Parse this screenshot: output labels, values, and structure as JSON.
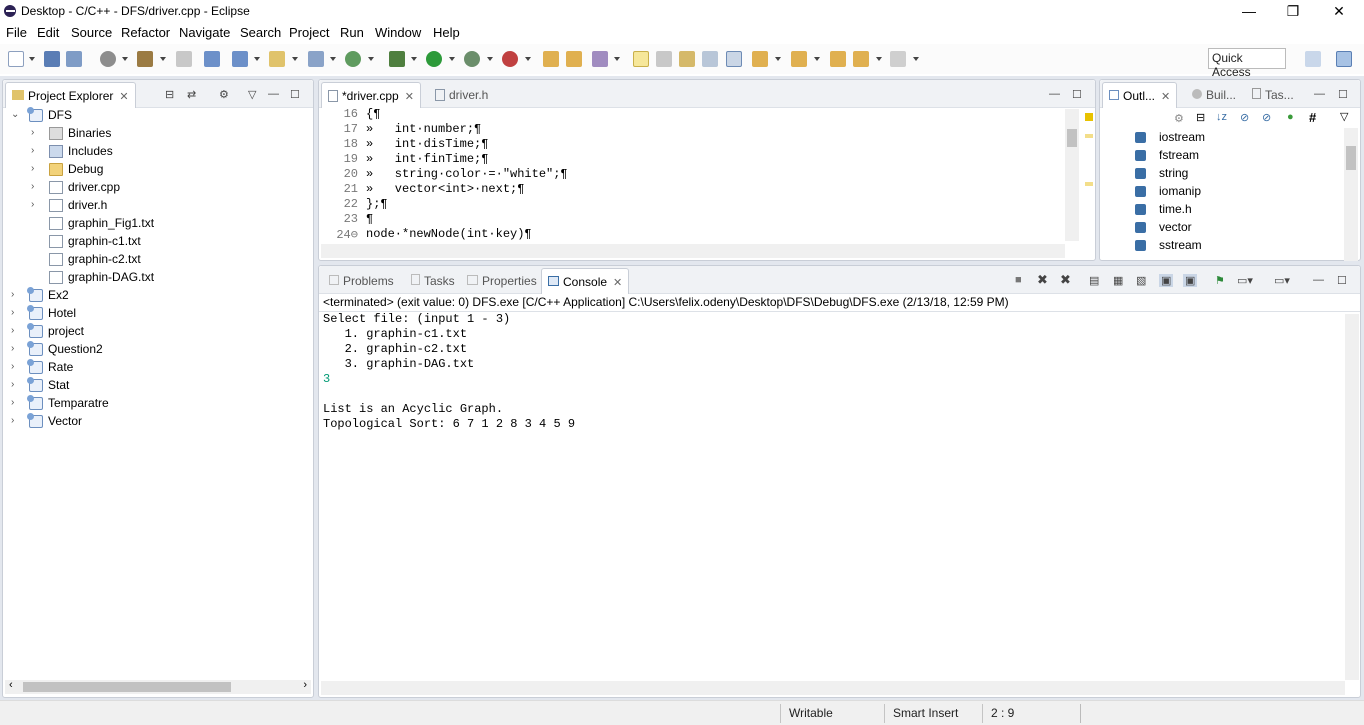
{
  "window": {
    "title": "Desktop - C/C++ - DFS/driver.cpp - Eclipse",
    "controls": {
      "minimize": "—",
      "restore": "❐",
      "close": "✕"
    }
  },
  "menu": [
    "File",
    "Edit",
    "Source",
    "Refactor",
    "Navigate",
    "Search",
    "Project",
    "Run",
    "Window",
    "Help"
  ],
  "toolbar": {
    "quick_access_placeholder": "Quick Access"
  },
  "project_explorer": {
    "title": "Project Explorer",
    "items": [
      {
        "label": "DFS",
        "level": 0,
        "expanded": true,
        "icon": "project-icon"
      },
      {
        "label": "Binaries",
        "level": 1,
        "expanded": false,
        "icon": "binaries-icon"
      },
      {
        "label": "Includes",
        "level": 1,
        "expanded": false,
        "icon": "includes-icon"
      },
      {
        "label": "Debug",
        "level": 1,
        "expanded": false,
        "icon": "folder-icon"
      },
      {
        "label": "driver.cpp",
        "level": 1,
        "expanded": false,
        "icon": "cpp-file-icon"
      },
      {
        "label": "driver.h",
        "level": 1,
        "expanded": false,
        "icon": "header-file-icon"
      },
      {
        "label": "graphin_Fig1.txt",
        "level": 1,
        "icon": "text-file-icon"
      },
      {
        "label": "graphin-c1.txt",
        "level": 1,
        "icon": "text-file-icon"
      },
      {
        "label": "graphin-c2.txt",
        "level": 1,
        "icon": "text-file-icon"
      },
      {
        "label": "graphin-DAG.txt",
        "level": 1,
        "icon": "text-file-icon"
      },
      {
        "label": "Ex2",
        "level": 0,
        "expanded": false,
        "icon": "project-icon"
      },
      {
        "label": "Hotel",
        "level": 0,
        "expanded": false,
        "icon": "project-icon"
      },
      {
        "label": "project",
        "level": 0,
        "expanded": false,
        "icon": "project-icon"
      },
      {
        "label": "Question2",
        "level": 0,
        "expanded": false,
        "icon": "project-icon"
      },
      {
        "label": "Rate",
        "level": 0,
        "expanded": false,
        "icon": "project-icon"
      },
      {
        "label": "Stat",
        "level": 0,
        "expanded": false,
        "icon": "project-icon"
      },
      {
        "label": "Temparatre",
        "level": 0,
        "expanded": false,
        "icon": "project-icon"
      },
      {
        "label": "Vector",
        "level": 0,
        "expanded": false,
        "icon": "project-icon"
      }
    ]
  },
  "editor": {
    "tabs": [
      {
        "label": "*driver.cpp",
        "active": true
      },
      {
        "label": "driver.h",
        "active": false
      }
    ],
    "lines": [
      {
        "n": "16",
        "text": "{¶"
      },
      {
        "n": "17",
        "text": "»   int·number;¶"
      },
      {
        "n": "18",
        "text": "»   int·disTime;¶"
      },
      {
        "n": "19",
        "text": "»   int·finTime;¶"
      },
      {
        "n": "20",
        "text": "»   string·color·=·\"white\";¶"
      },
      {
        "n": "21",
        "text": "»   vector<int>·next;¶"
      },
      {
        "n": "22",
        "text": "};¶"
      },
      {
        "n": "23",
        "text": "¶"
      },
      {
        "n": "24⊖",
        "text": "node·*newNode(int·key)¶"
      }
    ]
  },
  "outline": {
    "tabs": [
      {
        "label": "Outl...",
        "active": true
      },
      {
        "label": "Buil...",
        "active": false
      },
      {
        "label": "Tas...",
        "active": false
      }
    ],
    "items": [
      "iostream",
      "fstream",
      "string",
      "iomanip",
      "time.h",
      "vector",
      "sstream"
    ]
  },
  "bottom": {
    "tabs": [
      {
        "label": "Problems",
        "active": false
      },
      {
        "label": "Tasks",
        "active": false
      },
      {
        "label": "Properties",
        "active": false
      },
      {
        "label": "Console",
        "active": true
      }
    ],
    "status": "<terminated> (exit value: 0) DFS.exe [C/C++ Application] C:\\Users\\felix.odeny\\Desktop\\DFS\\Debug\\DFS.exe (2/13/18, 12:59 PM)",
    "console_lines": [
      {
        "text": "Select file: (input 1 - 3)",
        "input": false
      },
      {
        "text": "   1. graphin-c1.txt",
        "input": false
      },
      {
        "text": "   2. graphin-c2.txt",
        "input": false
      },
      {
        "text": "   3. graphin-DAG.txt",
        "input": false
      },
      {
        "text": "3",
        "input": true
      },
      {
        "text": "",
        "input": false
      },
      {
        "text": "List is an Acyclic Graph.",
        "input": false
      },
      {
        "text": "Topological Sort: 6 7 1 2 8 3 4 5 9",
        "input": false
      }
    ]
  },
  "statusbar": {
    "mode": "Writable",
    "insert": "Smart Insert",
    "position": "2 : 9"
  }
}
